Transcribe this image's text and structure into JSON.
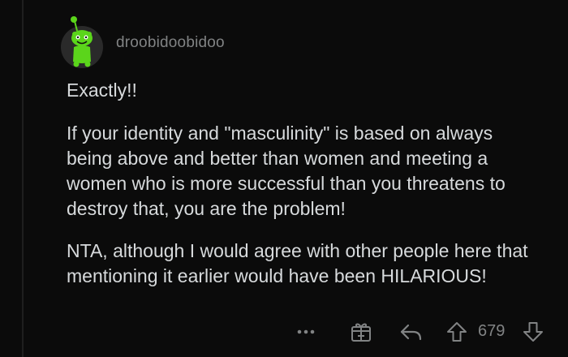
{
  "comment": {
    "username": "droobidoobidoo",
    "paragraphs": [
      "Exactly!!",
      "If your identity and \"masculinity\" is based on always being above and better than women and meeting a women who is more successful than you threatens to destroy that, you are the problem!",
      "NTA, although I would agree with other people here that mentioning it earlier would have been HILARIOUS!"
    ],
    "score": "679"
  },
  "actions": {
    "more_icon": "more-dots-icon",
    "award_icon": "gift-icon",
    "reply_icon": "reply-arrow-icon",
    "upvote_icon": "upvote-arrow-icon",
    "downvote_icon": "downvote-arrow-icon"
  },
  "colors": {
    "background": "#0b0b0b",
    "text": "#d7dadc",
    "muted": "#818384",
    "avatar_green": "#5bd51b"
  }
}
